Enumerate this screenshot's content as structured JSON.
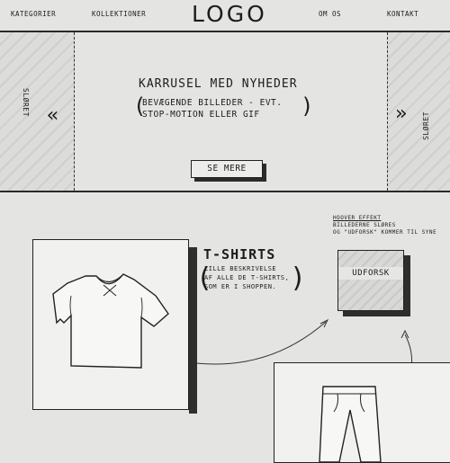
{
  "header": {
    "nav_left": [
      "Kategorier",
      "Kollektioner"
    ],
    "logo": "LOGO",
    "nav_right": [
      "Om os",
      "Kontakt"
    ]
  },
  "carousel": {
    "title": "KARRUSEL MED NYHEDER",
    "note_line1": "BEVÆGENDE BILLEDER - EVT.",
    "note_line2": "STOP-MOTION ELLER GIF",
    "left_label": "Sløret",
    "right_label": "Sløret",
    "button_label": "SE MERE"
  },
  "products": {
    "tshirt": {
      "title": "T-SHIRTS",
      "desc_lines": [
        "Lille beskrivelse",
        "af alle de T-shirts,",
        "som er i shoppen."
      ]
    },
    "hover_note": {
      "title": "Hoover effekt",
      "line1": "Billederne sløres",
      "line2": "og \"Udforsk\" kommer til syne"
    },
    "explore_button": "UDFORSK"
  }
}
